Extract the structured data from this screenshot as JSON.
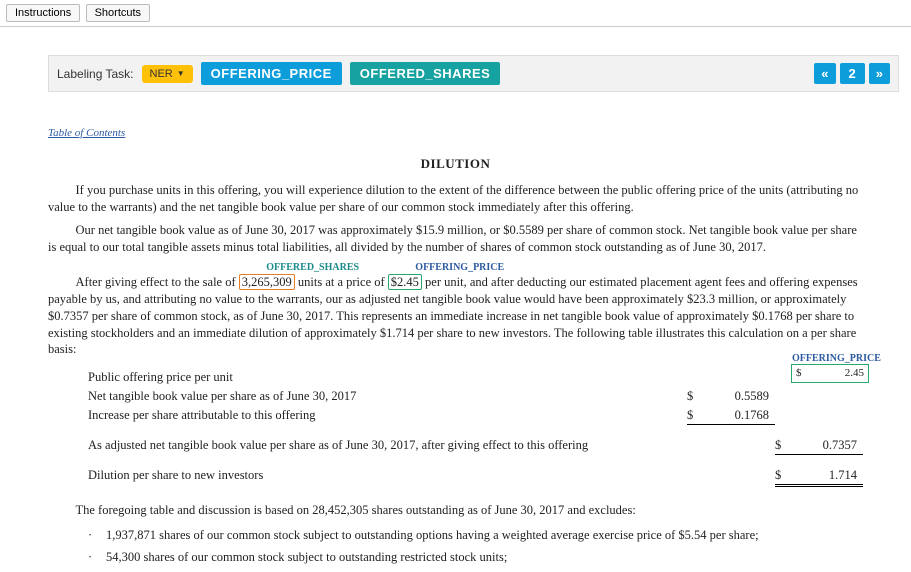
{
  "toolbar": {
    "instructions": "Instructions",
    "shortcuts": "Shortcuts"
  },
  "taskbar": {
    "label": "Labeling Task:",
    "ner": "NER",
    "offering_price": "OFFERING_PRICE",
    "offered_shares": "OFFERED_SHARES",
    "prev": "«",
    "page": "2",
    "next": "»"
  },
  "doc": {
    "toc": "Table of Contents",
    "title": "DILUTION",
    "p1": "If you purchase units in this offering, you will experience dilution to the extent of the difference between the public offering price of the units (attributing no value to the warrants) and the net tangible book value per share of our common stock immediately after this offering.",
    "p2": "Our net tangible book value as of June 30, 2017 was approximately $15.9 million, or $0.5589 per share of common stock. Net tangible book value per share is equal to our total tangible assets minus total liabilities, all divided by the number of shares of common stock outstanding as of June 30, 2017.",
    "p3a": "After giving effect to the sale of ",
    "p3_shares": "3,265,309",
    "p3b": " units at a price of ",
    "p3_price": "$2.45",
    "p3c": " per unit, and after deducting our estimated placement agent fees and offering expenses payable by us, and attributing no value to the warrants, our as adjusted net tangible book value would have been approximately $23.3 million, or approximately $0.7357 per share of common stock, as of June 30, 2017. This represents an immediate increase in net tangible book value of approximately $0.1768 per share to existing stockholders and an immediate dilution of approximately $1.714 per share to new investors. The following table illustrates this calculation on a per share basis:",
    "ann_shares_label": "OFFERED_SHARES",
    "ann_price_label": "OFFERING_PRICE",
    "table": {
      "r1": "Public offering price per unit",
      "r2": "Net tangible book value per share as of June 30, 2017",
      "r3": "Increase per share attributable to this offering",
      "r4": "As adjusted net tangible book value per share as of June 30, 2017, after giving effect to this offering",
      "r5": "Dilution per share to new investors",
      "sym": "$",
      "v2": "0.5589",
      "v3": "0.1768",
      "v4": "0.7357",
      "v5": "1.714",
      "callout_price": "2.45",
      "callout_label": "OFFERING_PRICE"
    },
    "p4": "The foregoing table and discussion is based on 28,452,305 shares outstanding as of June 30, 2017 and excludes:",
    "li1": "1,937,871 shares of our common stock subject to outstanding options having a weighted average exercise price of $5.54 per share;",
    "li2": "54,300 shares of our common stock subject to outstanding restricted stock units;"
  }
}
